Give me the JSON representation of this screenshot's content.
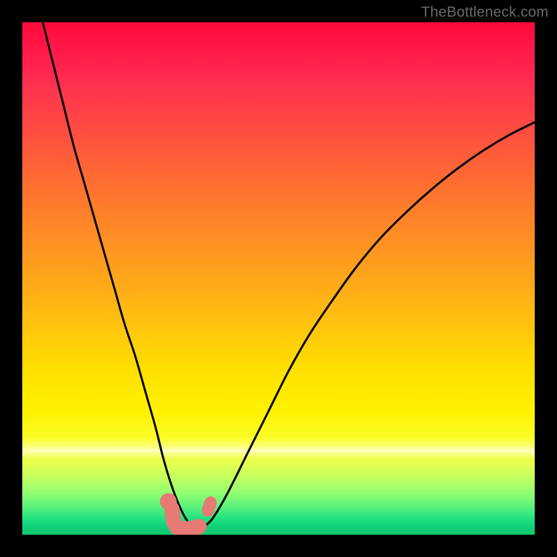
{
  "watermark": "TheBottleneck.com",
  "chart_data": {
    "type": "line",
    "title": "",
    "xlabel": "",
    "ylabel": "",
    "xlim": [
      0,
      100
    ],
    "ylim": [
      0,
      100
    ],
    "grid": false,
    "series": [
      {
        "name": "bottleneck-curve",
        "x": [
          4,
          6,
          8,
          10,
          12,
          14,
          16,
          18,
          20,
          22,
          24,
          26,
          27.5,
          29,
          30.5,
          32,
          33.5,
          35,
          37,
          40,
          44,
          48,
          52,
          56,
          60,
          65,
          70,
          75,
          80,
          85,
          90,
          95,
          100
        ],
        "values": [
          100,
          92,
          84,
          76,
          69,
          62,
          55,
          48,
          41,
          35,
          28,
          21,
          15,
          10,
          6,
          3,
          1.5,
          1.5,
          3,
          8,
          16,
          24,
          32,
          39,
          45,
          52,
          58,
          63,
          67.5,
          71.5,
          75,
          78,
          80.5
        ]
      }
    ],
    "annotations": {
      "highlight_dots": [
        {
          "x": 28.5,
          "y": 6.5
        },
        {
          "x": 36.5,
          "y": 5.5
        }
      ],
      "highlight_hook": {
        "path_x": [
          29.2,
          29.5,
          30.2,
          31.5,
          33.0,
          34.5
        ],
        "path_y": [
          5.0,
          2.6,
          1.4,
          1.1,
          1.2,
          1.6
        ]
      }
    },
    "background_gradient": {
      "orientation": "vertical",
      "stops": [
        {
          "pos": 0.0,
          "color": "#ff0a3a"
        },
        {
          "pos": 0.22,
          "color": "#ff5040"
        },
        {
          "pos": 0.5,
          "color": "#ffa61a"
        },
        {
          "pos": 0.76,
          "color": "#fff200"
        },
        {
          "pos": 0.9,
          "color": "#c0ff60"
        },
        {
          "pos": 1.0,
          "color": "#10c870"
        }
      ]
    }
  }
}
